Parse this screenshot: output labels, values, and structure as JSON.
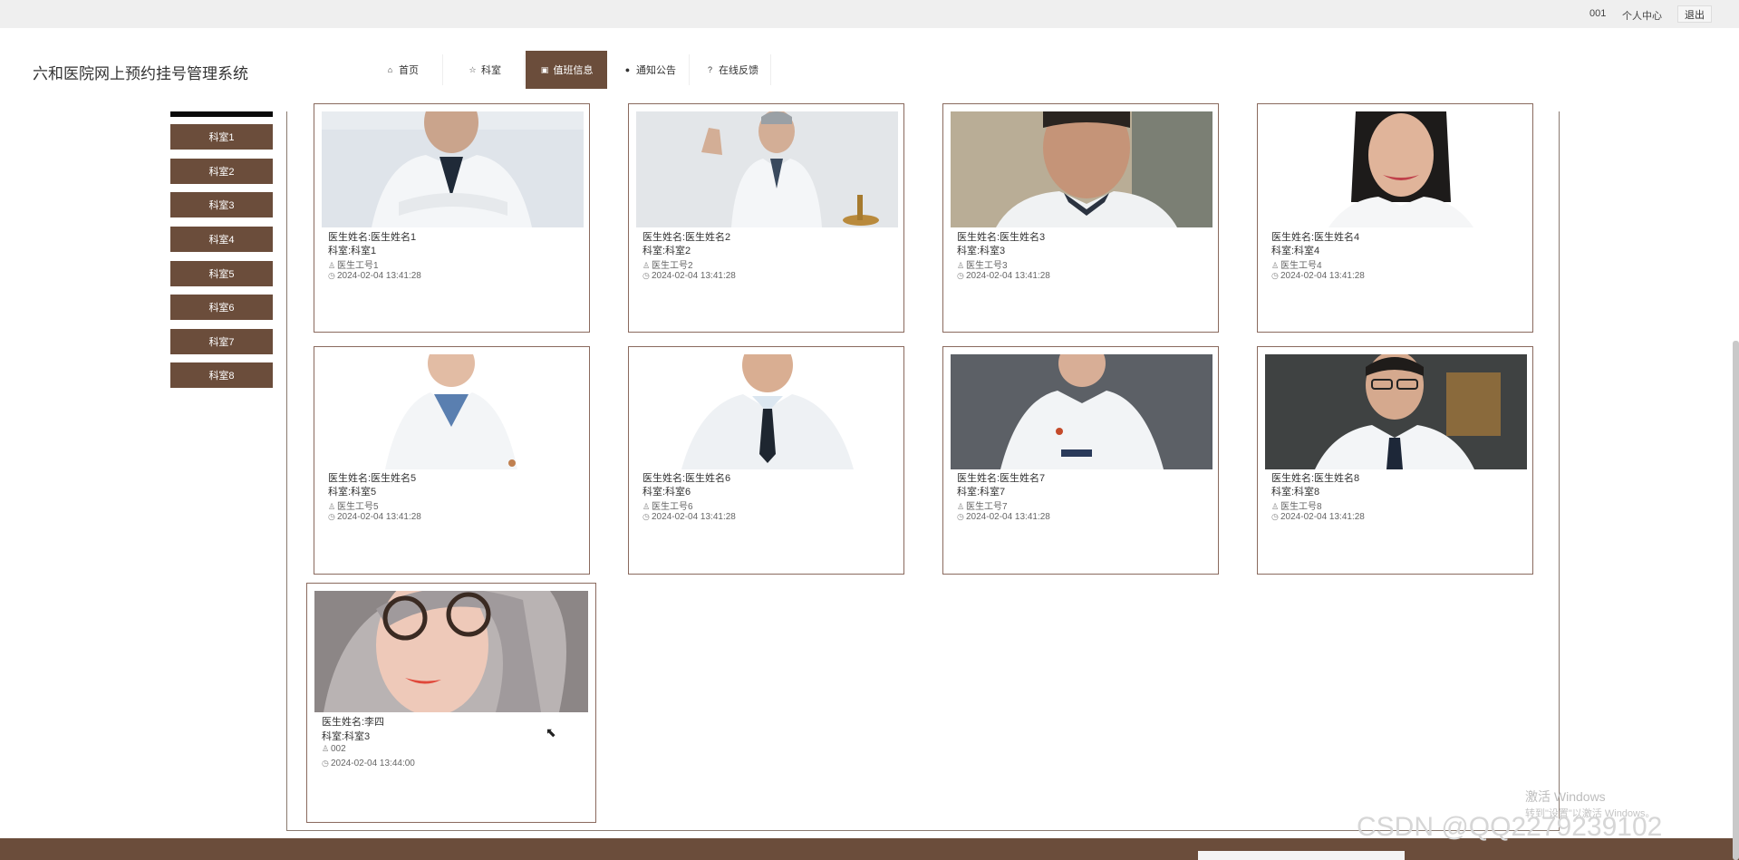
{
  "topbar": {
    "user": "001",
    "profile": "个人中心",
    "logout": "退出"
  },
  "header": {
    "title": "六和医院网上预约挂号管理系统",
    "nav": [
      {
        "label": "首页",
        "icon": "home-icon",
        "glyph": "⌂"
      },
      {
        "label": "科室",
        "icon": "star-icon",
        "glyph": "☆"
      },
      {
        "label": "值班信息",
        "icon": "bag-icon",
        "glyph": "▣"
      },
      {
        "label": "通知公告",
        "icon": "info-icon",
        "glyph": "●"
      },
      {
        "label": "在线反馈",
        "icon": "question-icon",
        "glyph": "?"
      }
    ]
  },
  "sidebar": {
    "items": [
      "科室1",
      "科室2",
      "科室3",
      "科室4",
      "科室5",
      "科室6",
      "科室7",
      "科室8"
    ]
  },
  "cards": [
    {
      "name": "医生姓名:医生姓名1",
      "dept": "科室:科室1",
      "id": "医生工号1",
      "time": "2024-02-04 13:41:28"
    },
    {
      "name": "医生姓名:医生姓名2",
      "dept": "科室:科室2",
      "id": "医生工号2",
      "time": "2024-02-04 13:41:28"
    },
    {
      "name": "医生姓名:医生姓名3",
      "dept": "科室:科室3",
      "id": "医生工号3",
      "time": "2024-02-04 13:41:28"
    },
    {
      "name": "医生姓名:医生姓名4",
      "dept": "科室:科室4",
      "id": "医生工号4",
      "time": "2024-02-04 13:41:28"
    },
    {
      "name": "医生姓名:医生姓名5",
      "dept": "科室:科室5",
      "id": "医生工号5",
      "time": "2024-02-04 13:41:28"
    },
    {
      "name": "医生姓名:医生姓名6",
      "dept": "科室:科室6",
      "id": "医生工号6",
      "time": "2024-02-04 13:41:28"
    },
    {
      "name": "医生姓名:医生姓名7",
      "dept": "科室:科室7",
      "id": "医生工号7",
      "time": "2024-02-04 13:41:28"
    },
    {
      "name": "医生姓名:医生姓名8",
      "dept": "科室:科室8",
      "id": "医生工号8",
      "time": "2024-02-04 13:41:28"
    },
    {
      "name": "医生姓名:李四",
      "dept": "科室:科室3",
      "id": "002",
      "time": "2024-02-04 13:44:00"
    }
  ],
  "watermark": {
    "activate_title": "激活 Windows",
    "activate_sub": "转到\"设置\"以激活 Windows。",
    "csdn": "CSDN @QQ2279239102"
  },
  "colors": {
    "brand": "#6b4d3b",
    "card_border": "#8a6a5e"
  }
}
